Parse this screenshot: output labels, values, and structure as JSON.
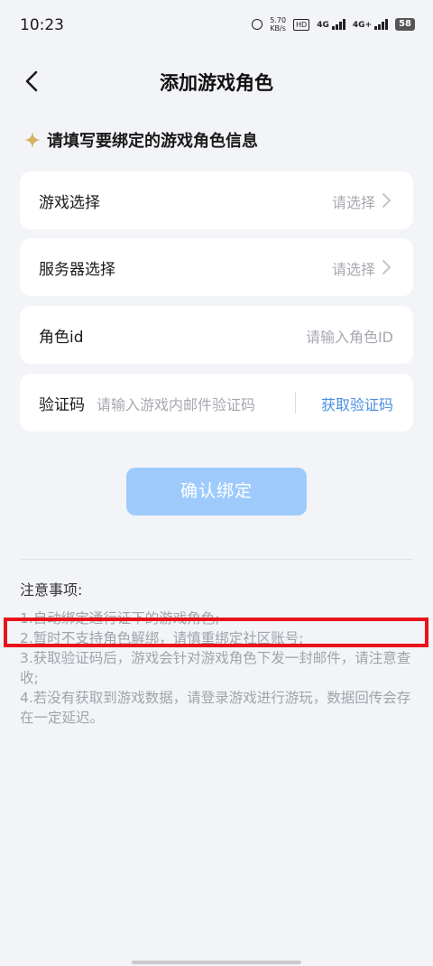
{
  "status_bar": {
    "time": "10:23",
    "speed_value": "5.70",
    "speed_unit": "KB/s",
    "hd_label": "HD",
    "signal1_label": "4G",
    "signal2_label": "4G+",
    "battery": "58"
  },
  "header": {
    "title": "添加游戏角色"
  },
  "section": {
    "title": "请填写要绑定的游戏角色信息"
  },
  "form": {
    "game": {
      "label": "游戏选择",
      "placeholder": "请选择"
    },
    "server": {
      "label": "服务器选择",
      "placeholder": "请选择"
    },
    "role_id": {
      "label": "角色id",
      "placeholder": "请输入角色ID"
    },
    "code": {
      "label": "验证码",
      "placeholder": "请输入游戏内邮件验证码",
      "action": "获取验证码"
    }
  },
  "confirm_button": {
    "label": "确认绑定"
  },
  "notes": {
    "title": "注意事项:",
    "items": [
      "1.自动绑定通行证下的游戏角色;",
      "2.暂时不支持角色解绑，请慎重绑定社区账号;",
      "3.获取验证码后，游戏会针对游戏角色下发一封邮件，请注意查收;",
      "4.若没有获取到游戏数据，请登录游戏进行游玩，数据回传会存在一定延迟。"
    ]
  },
  "colors": {
    "accent": "#4a90e2",
    "button": "#9ecbfb",
    "highlight": "#e8121c",
    "sparkle": "#d4b25f"
  }
}
